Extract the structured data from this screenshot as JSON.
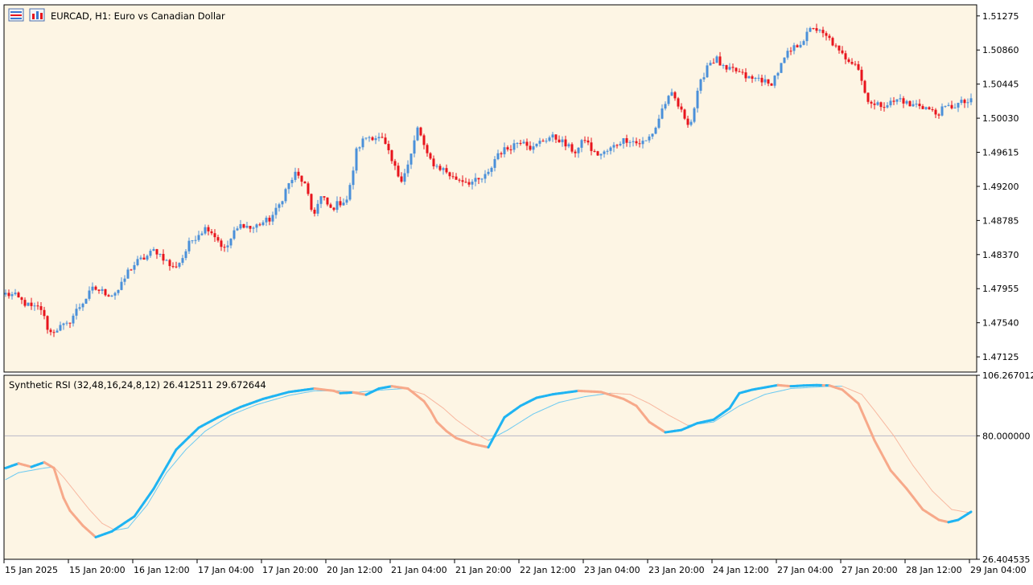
{
  "header": {
    "symbol_title": "EURCAD, H1:  Euro vs Canadian Dollar",
    "indicator_title": "Synthetic RSI (32,48,16,24,8,12) 26.412511 29.672644"
  },
  "colors": {
    "background": "#fdf5e4",
    "bull": "#4a90d9",
    "bear": "#e8141c",
    "rsi_up": "#1fb4f2",
    "rsi_down": "#f7a98a",
    "signal_up": "#6ccaf2",
    "signal_down": "#f8b8a0",
    "grid_level": "#b8b8c8"
  },
  "icons": [
    "chart-window-icon",
    "chart-properties-icon"
  ],
  "chart_data": [
    {
      "type": "candlestick",
      "symbol": "EURCAD",
      "timeframe": "H1",
      "ylim": [
        1.4694,
        1.5141
      ],
      "y_ticks": [
        "1.51275",
        "1.50860",
        "1.50445",
        "1.50030",
        "1.49615",
        "1.49200",
        "1.48785",
        "1.48370",
        "1.47955",
        "1.47540",
        "1.47125"
      ],
      "y_tick_values": [
        1.51275,
        1.5086,
        1.50445,
        1.5003,
        1.49615,
        1.492,
        1.48785,
        1.4837,
        1.47955,
        1.4754,
        1.47125
      ],
      "x_ticks": [
        "15 Jan 2025",
        "15 Jan 20:00",
        "16 Jan 12:00",
        "17 Jan 04:00",
        "17 Jan 20:00",
        "20 Jan 12:00",
        "21 Jan 04:00",
        "21 Jan 20:00",
        "22 Jan 12:00",
        "23 Jan 04:00",
        "23 Jan 20:00",
        "24 Jan 12:00",
        "27 Jan 04:00",
        "27 Jan 20:00",
        "28 Jan 12:00",
        "29 Jan 04:00"
      ],
      "close_anchors": [
        1.4789,
        1.4787,
        1.4779,
        1.4772,
        1.4772,
        1.4741,
        1.4748,
        1.4751,
        1.4768,
        1.4782,
        1.4796,
        1.4792,
        1.4788,
        1.4795,
        1.4818,
        1.4828,
        1.4834,
        1.4843,
        1.4833,
        1.482,
        1.483,
        1.4852,
        1.4863,
        1.4871,
        1.4858,
        1.4842,
        1.4863,
        1.4875,
        1.4868,
        1.4875,
        1.4879,
        1.4893,
        1.4918,
        1.4935,
        1.4925,
        1.4885,
        1.4908,
        1.4892,
        1.49,
        1.4905,
        1.4965,
        1.498,
        1.4981,
        1.4976,
        1.495,
        1.4928,
        1.495,
        1.4993,
        1.4957,
        1.4945,
        1.494,
        1.493,
        1.4928,
        1.4925,
        1.4927,
        1.4935,
        1.496,
        1.4965,
        1.4972,
        1.4978,
        1.4965,
        1.4975,
        1.498,
        1.4978,
        1.4968,
        1.4962,
        1.4978,
        1.496,
        1.4959,
        1.4966,
        1.4975,
        1.4978,
        1.4972,
        1.4975,
        1.499,
        1.502,
        1.5032,
        1.501,
        1.4995,
        1.504,
        1.507,
        1.5075,
        1.506,
        1.5062,
        1.5055,
        1.505,
        1.5052,
        1.5042,
        1.506,
        1.508,
        1.509,
        1.51,
        1.5115,
        1.5105,
        1.5098,
        1.5082,
        1.5075,
        1.507,
        1.503,
        1.5018,
        1.502,
        1.5022,
        1.5027,
        1.5018,
        1.502,
        1.5015,
        1.5008,
        1.5015,
        1.5018,
        1.5022,
        1.5023
      ]
    },
    {
      "type": "line",
      "title": "Synthetic RSI (32,48,16,24,8,12)",
      "current_values": [
        26.412511,
        29.672644
      ],
      "ylim": [
        26.404535,
        106.267012
      ],
      "y_ticks": [
        "106.267012",
        "80.000000",
        "26.404535"
      ],
      "level": 80.0,
      "series": [
        {
          "role": "rsi",
          "x_index": [
            0,
            4,
            8,
            12,
            15,
            18,
            20,
            24,
            28,
            33,
            40,
            46,
            53,
            60,
            66,
            73,
            80,
            88,
            96,
            102,
            104,
            108,
            112,
            116,
            120,
            125,
            130,
            132,
            134,
            137,
            140,
            145,
            150,
            155,
            160,
            165,
            170,
            178,
            185,
            192,
            196,
            200,
            205,
            210,
            215,
            220,
            225,
            228,
            232,
            236,
            240,
            244,
            248,
            252,
            256,
            260,
            265,
            270,
            275,
            280,
            285,
            290,
            293,
            296,
            300
          ],
          "values": [
            66.0,
            68.0,
            66.5,
            68.5,
            66.0,
            53.0,
            47.5,
            41.0,
            36.0,
            38.5,
            45.0,
            57.0,
            74.0,
            83.5,
            88.0,
            92.5,
            96.0,
            99.0,
            100.5,
            99.5,
            98.5,
            98.8,
            97.8,
            100.5,
            101.5,
            100.5,
            95.0,
            91.0,
            86.0,
            82.0,
            79.0,
            76.5,
            75.0,
            88.0,
            93.0,
            96.5,
            98.0,
            99.5,
            99.0,
            96.0,
            93.0,
            86.0,
            81.5,
            82.5,
            85.5,
            87.0,
            92.0,
            98.5,
            100.0,
            101.0,
            102.0,
            101.5,
            101.8,
            102.0,
            101.8,
            100.0,
            94.0,
            78.0,
            65.0,
            57.0,
            48.0,
            43.5,
            42.5,
            43.5,
            47.0
          ]
        },
        {
          "role": "signal",
          "x_index": [
            0,
            4,
            8,
            12,
            15,
            18,
            22,
            26,
            30,
            34,
            38,
            44,
            50,
            56,
            62,
            70,
            78,
            88,
            96,
            104,
            110,
            118,
            124,
            130,
            136,
            140,
            146,
            150,
            156,
            164,
            172,
            180,
            188,
            194,
            200,
            206,
            212,
            220,
            228,
            236,
            244,
            250,
            256,
            260,
            266,
            270,
            276,
            282,
            288,
            294,
            300
          ],
          "values": [
            61.0,
            64.0,
            65.0,
            66.0,
            66.5,
            62.0,
            55.0,
            48.0,
            42.0,
            39.0,
            40.0,
            50.0,
            64.0,
            74.0,
            82.0,
            89.0,
            93.5,
            97.5,
            99.5,
            99.5,
            99.0,
            100.0,
            100.5,
            98.0,
            92.0,
            87.0,
            81.0,
            78.0,
            82.5,
            89.5,
            94.5,
            97.0,
            98.5,
            98.0,
            94.0,
            89.0,
            84.5,
            86.0,
            93.0,
            98.0,
            100.5,
            101.0,
            101.5,
            101.5,
            98.0,
            91.0,
            80.0,
            67.0,
            56.0,
            48.0,
            46.5
          ]
        }
      ]
    }
  ]
}
